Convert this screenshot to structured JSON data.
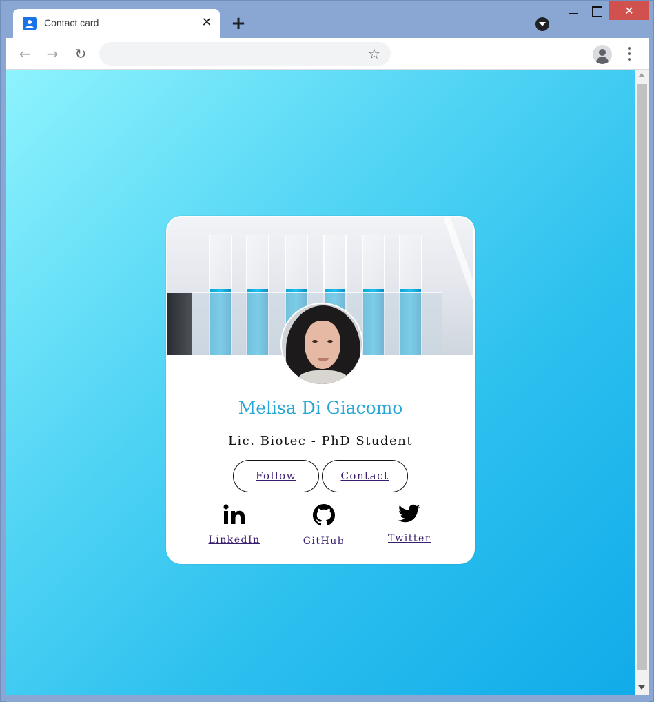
{
  "browser": {
    "tab_title": "Contact card",
    "tab_close_glyph": "✕",
    "new_tab_glyph": "+",
    "window_close_glyph": "✕",
    "address_value": "",
    "nav_back_glyph": "←",
    "nav_forward_glyph": "→",
    "reload_glyph": "↻",
    "star_glyph": "☆"
  },
  "card": {
    "name": "Melisa Di Giacomo",
    "subtitle": "Lic. Biotec - PhD Student",
    "buttons": {
      "follow": "Follow",
      "contact": "Contact"
    },
    "social": [
      {
        "label": "LinkedIn",
        "icon": "linkedin-icon"
      },
      {
        "label": "GitHub",
        "icon": "github-icon"
      },
      {
        "label": "Twitter",
        "icon": "twitter-icon"
      }
    ]
  },
  "colors": {
    "name": "#27a6d6",
    "link": "#3a1d6e",
    "background_start": "#8ef3fd",
    "background_end": "#11abea",
    "window_frame": "#8aa7d4",
    "window_close": "#d0514d"
  }
}
